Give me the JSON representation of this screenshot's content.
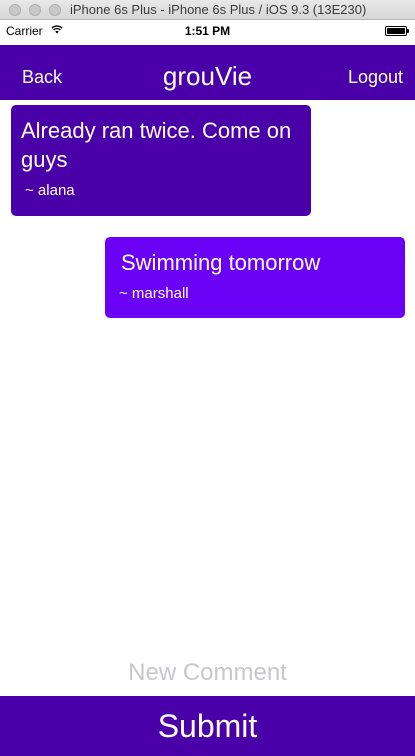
{
  "window": {
    "title": "iPhone 6s Plus - iPhone 6s Plus / iOS 9.3 (13E230)"
  },
  "status_bar": {
    "carrier": "Carrier",
    "time": "1:51 PM",
    "wifi_icon": "wifi-icon",
    "battery_icon": "battery-icon"
  },
  "nav": {
    "back_label": "Back",
    "title": "grouVie",
    "logout_label": "Logout"
  },
  "comments": [
    {
      "text": "Already ran twice. Come on guys",
      "author": "~ alana",
      "color": "#4a00a8"
    },
    {
      "text": "Swimming tomorrow",
      "author": "~ marshall",
      "color": "#6a00f4"
    }
  ],
  "new_comment": {
    "placeholder": "New Comment",
    "value": ""
  },
  "submit_label": "Submit",
  "colors": {
    "accent": "#4a00a8",
    "accent_light": "#6a00f4"
  }
}
